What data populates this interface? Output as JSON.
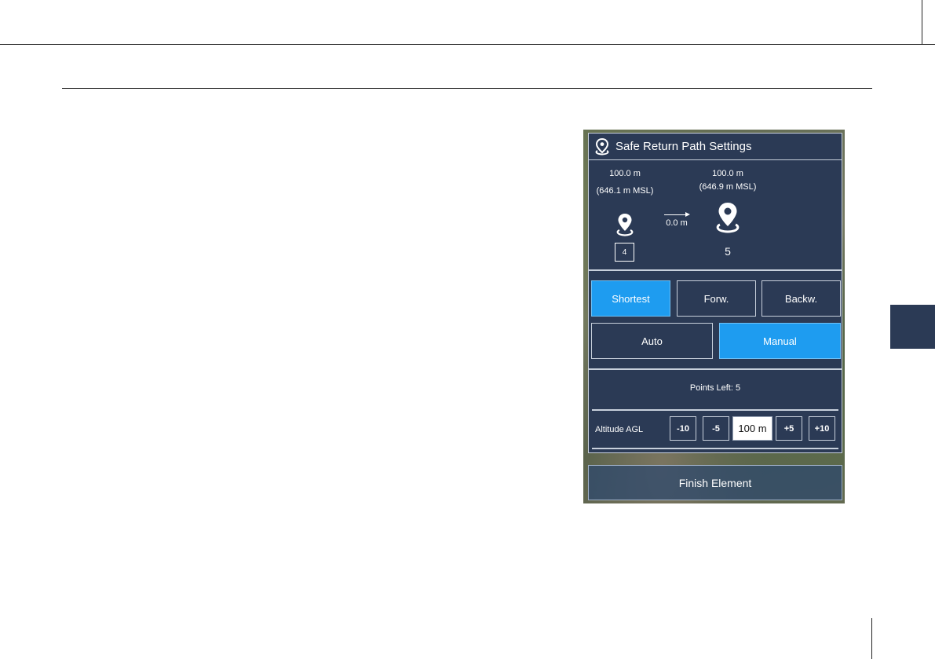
{
  "panel": {
    "title": "Safe Return Path Settings",
    "from": {
      "altitude": "100.0 m",
      "msl": "(646.1 m MSL)",
      "index": "4"
    },
    "to": {
      "altitude": "100.0 m",
      "msl": "(646.9 m MSL)",
      "index": "5"
    },
    "distance": "0.0 m",
    "direction_buttons": [
      "Shortest",
      "Forw.",
      "Backw."
    ],
    "direction_selected": "Shortest",
    "mode_buttons": [
      "Auto",
      "Manual"
    ],
    "mode_selected": "Manual",
    "points_left": "Points Left: 5",
    "altitude_label": "Altitude AGL",
    "altitude_steps": [
      "-10",
      "-5",
      "+5",
      "+10"
    ],
    "altitude_value": "100 m",
    "finish_label": "Finish Element"
  },
  "colors": {
    "panel_bg": "#2b3a55",
    "accent": "#1e9cf0",
    "side_tab": "#2b3a55"
  },
  "icons": {
    "header": "location-pin-icon",
    "waypoint": "location-pin-icon"
  }
}
